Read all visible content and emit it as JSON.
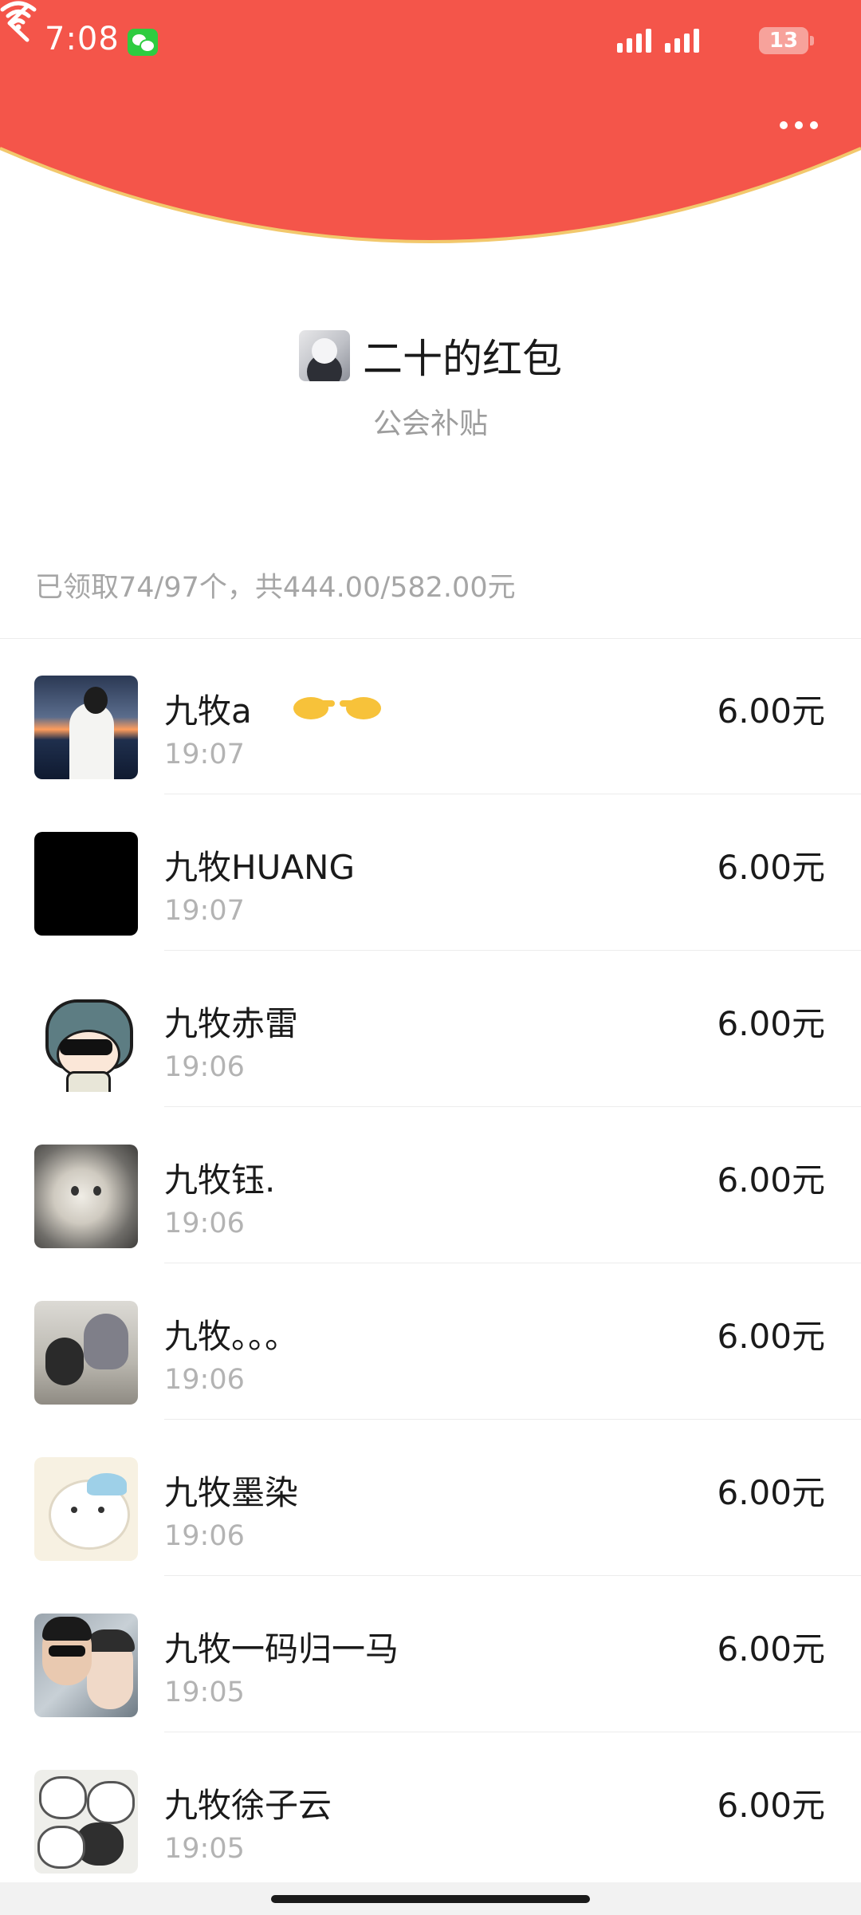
{
  "status_bar": {
    "time": "7:08",
    "battery": "13"
  },
  "header": {
    "sender_title": "二十的红包",
    "subtitle": "公会补贴",
    "accent_color": "#f4554a"
  },
  "summary": "已领取74/97个，共444.00/582.00元",
  "recipients": [
    {
      "name": "九牧a",
      "time": "19:07",
      "amount": "6.00元"
    },
    {
      "name": "九牧HUANG",
      "time": "19:07",
      "amount": "6.00元"
    },
    {
      "name": "九牧赤雷",
      "time": "19:06",
      "amount": "6.00元"
    },
    {
      "name": "九牧钰.",
      "time": "19:06",
      "amount": "6.00元"
    },
    {
      "name": "九牧。。。",
      "time": "19:06",
      "amount": "6.00元"
    },
    {
      "name": "九牧墨染",
      "time": "19:06",
      "amount": "6.00元"
    },
    {
      "name": "九牧一码归一马",
      "time": "19:05",
      "amount": "6.00元"
    },
    {
      "name": "九牧徐子云",
      "time": "19:05",
      "amount": "6.00元"
    }
  ]
}
